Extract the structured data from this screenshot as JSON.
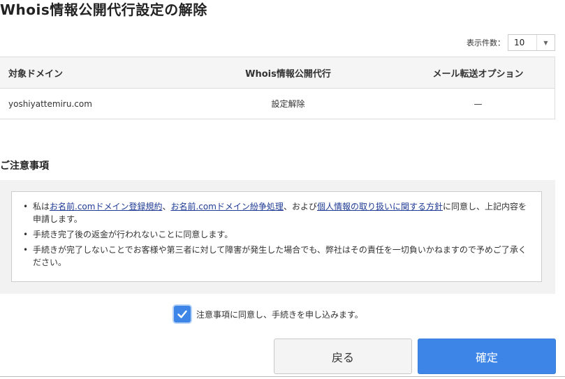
{
  "page": {
    "title": "Whois情報公開代行設定の解除"
  },
  "pagination": {
    "per_page_label": "表示件数：",
    "per_page_value": "10",
    "arrow_icon": "caret-down-icon"
  },
  "table": {
    "headers": [
      "対象ドメイン",
      "Whois情報公開代行",
      "メール転送オプション"
    ],
    "rows": [
      [
        "yoshiyattemiru.com",
        "設定解除",
        "—"
      ]
    ]
  },
  "notice": {
    "heading": "ご注意事項",
    "item1": {
      "t1": "私は",
      "link1": "お名前.comドメイン登録規約",
      "t2": "、",
      "link2": "お名前.comドメイン紛争処理",
      "t3": "、および",
      "link3": "個人情報の取り扱いに関する方針",
      "t4": "に同意し、上記内容を申請します。"
    },
    "item2": "手続き完了後の返金が行われないことに同意します。",
    "item3": "手続きが完了しないことでお客様や第三者に対して障害が発生した場合でも、弊社はその責任を一切負いかねますので予めご了承ください。"
  },
  "agreement": {
    "checked": true,
    "label": "注意事項に同意し、手続きを申し込みます。"
  },
  "buttons": {
    "back": "戻る",
    "confirm": "確定"
  },
  "colors": {
    "primary": "#3d86e8",
    "link": "#1f3b95"
  }
}
